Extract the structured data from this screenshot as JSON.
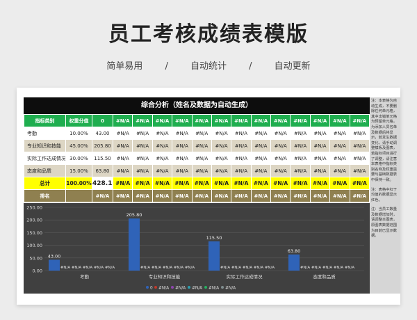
{
  "page": {
    "title": "员工考核成绩表模版",
    "features": [
      "简单易用",
      "/",
      "自动统计",
      "/",
      "自动更新"
    ]
  },
  "sheet": {
    "band_title": "综合分析（姓名及数据为自动生成）",
    "header": [
      "指标类别",
      "权重分值",
      "0",
      "#N/A",
      "#N/A",
      "#N/A",
      "#N/A",
      "#N/A",
      "#N/A",
      "#N/A",
      "#N/A",
      "#N/A",
      "#N/A",
      "#N/A",
      "#N/A",
      "#N/A"
    ],
    "rows": [
      [
        "考勤",
        "10.00%",
        "43.00",
        "#N/A",
        "#N/A",
        "#N/A",
        "#N/A",
        "#N/A",
        "#N/A",
        "#N/A",
        "#N/A",
        "#N/A",
        "#N/A",
        "#N/A",
        "#N/A",
        "#N/A"
      ],
      [
        "专业知识和技能",
        "45.00%",
        "205.80",
        "#N/A",
        "#N/A",
        "#N/A",
        "#N/A",
        "#N/A",
        "#N/A",
        "#N/A",
        "#N/A",
        "#N/A",
        "#N/A",
        "#N/A",
        "#N/A",
        "#N/A"
      ],
      [
        "实际工作达成情况",
        "30.00%",
        "115.50",
        "#N/A",
        "#N/A",
        "#N/A",
        "#N/A",
        "#N/A",
        "#N/A",
        "#N/A",
        "#N/A",
        "#N/A",
        "#N/A",
        "#N/A",
        "#N/A",
        "#N/A"
      ],
      [
        "态度和品质",
        "15.00%",
        "63.80",
        "#N/A",
        "#N/A",
        "#N/A",
        "#N/A",
        "#N/A",
        "#N/A",
        "#N/A",
        "#N/A",
        "#N/A",
        "#N/A",
        "#N/A",
        "#N/A",
        "#N/A"
      ]
    ],
    "total": [
      "总计",
      "100.00%",
      "428.10",
      "#N/A",
      "#N/A",
      "#N/A",
      "#N/A",
      "#N/A",
      "#N/A",
      "#N/A",
      "#N/A",
      "#N/A",
      "#N/A",
      "#N/A",
      "#N/A",
      "#N/A"
    ],
    "rank": [
      "排名",
      "",
      "#N/A",
      "#N/A",
      "#N/A",
      "#N/A",
      "#N/A",
      "#N/A",
      "#N/A",
      "#N/A",
      "#N/A",
      "#N/A",
      "#N/A",
      "#N/A",
      "#N/A",
      "#N/A"
    ],
    "notes": [
      "注：本表格为自动生成，不要删除任何单元格，其中出错单元格为预留单元格，为添加人员名单及数据后将显示，若发生数据变化，请手动调整模板及图表，若指标项目进行了调整，请注意本表格中指标类别名称及权重需要与基础数据表中保持一致。",
      "注：表格中红于均值的数据显示红色。",
      "注：当员工数量及数据增加时，请调整本图表，原图表数据范围为目前已显示数据。"
    ],
    "colors": {
      "header_green": "#1fae4f",
      "band_black": "#0d0d0d",
      "total_yellow": "#ffff00",
      "rank_brown": "#8f8050",
      "stripe": "#ddd6c4",
      "bar_blue": "#2f63b8",
      "chart_bg": "#404040"
    }
  },
  "chart_data": {
    "type": "bar",
    "categories": [
      "考勤",
      "专业知识和技能",
      "实际工作达成情况",
      "态度和品质"
    ],
    "series": [
      {
        "name": "0",
        "values": [
          43.0,
          205.8,
          115.5,
          63.8
        ],
        "labels": [
          "43.00",
          "205.80",
          "115.50",
          "63.80"
        ]
      },
      {
        "name": "#N/A",
        "values": [
          null,
          null,
          null,
          null
        ],
        "labels": [
          "#N/A",
          "#N/A",
          "#N/A",
          "#N/A"
        ]
      },
      {
        "name": "#N/A",
        "values": [
          null,
          null,
          null,
          null
        ],
        "labels": [
          "#N/A",
          "#N/A",
          "#N/A",
          "#N/A"
        ]
      },
      {
        "name": "#N/A",
        "values": [
          null,
          null,
          null,
          null
        ],
        "labels": [
          "#N/A",
          "#N/A",
          "#N/A",
          "#N/A"
        ]
      },
      {
        "name": "#N/A",
        "values": [
          null,
          null,
          null,
          null
        ],
        "labels": [
          "#N/A",
          "#N/A",
          "#N/A",
          "#N/A"
        ]
      },
      {
        "name": "#N/A",
        "values": [
          null,
          null,
          null,
          null
        ],
        "labels": [
          "#N/A",
          "#N/A",
          "#N/A",
          "#N/A"
        ]
      }
    ],
    "yticks": [
      "0.00",
      "50.00",
      "100.00",
      "150.00",
      "200.00",
      "250.00"
    ],
    "ylim": [
      0,
      250
    ],
    "legend_position": "bottom",
    "series_colors": [
      "#2f63b8",
      "#c0392b",
      "#8e44ad",
      "#2c9fb0",
      "#27ae60",
      "#7f8c8d"
    ]
  }
}
